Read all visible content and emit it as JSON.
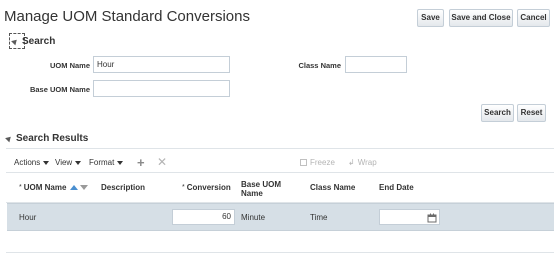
{
  "page": {
    "title": "Manage UOM Standard Conversions"
  },
  "toolbar": {
    "save": "Save",
    "save_and_close": "Save and Close",
    "cancel": "Cancel"
  },
  "search": {
    "heading": "Search",
    "uom_name_label": "UOM Name",
    "uom_name_value": "Hour",
    "class_name_label": "Class Name",
    "class_name_value": "",
    "base_uom_name_label": "Base UOM Name",
    "base_uom_name_value": "",
    "search_button": "Search",
    "reset_button": "Reset"
  },
  "results": {
    "heading": "Search Results",
    "menus": {
      "actions": "Actions",
      "view": "View",
      "format": "Format"
    },
    "freeze": "Freeze",
    "wrap": "Wrap",
    "columns": {
      "uom_name": "UOM Name",
      "description": "Description",
      "conversion": "Conversion",
      "base_uom_name": "Base UOM Name",
      "class_name": "Class Name",
      "end_date": "End Date"
    },
    "rows": [
      {
        "uom_name": "Hour",
        "description": "",
        "conversion": "60",
        "base_uom_name": "Minute",
        "class_name": "Time",
        "end_date": ""
      }
    ]
  },
  "icons": {
    "add": "plus-icon",
    "delete": "x-icon",
    "freeze": "freeze-icon",
    "wrap": "wrap-icon",
    "calendar": "calendar-icon"
  },
  "colors": {
    "selected_row": "#d6dfe6",
    "sort_accent": "#4a8fd0"
  }
}
